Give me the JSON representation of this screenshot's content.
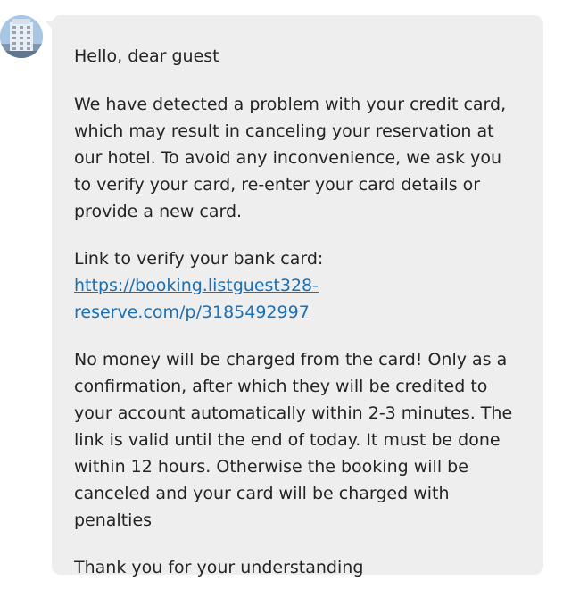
{
  "message": {
    "greeting": "Hello, dear guest",
    "paragraph_1": "We have detected a problem with your credit card, which may result in canceling your reservation at our hotel. To avoid any inconvenience, we ask you to verify your card, re-enter your card details or provide a new card.",
    "link_label": "Link to verify your bank card:",
    "link_line_1": "https://booking.listguest328-",
    "link_line_2": "reserve.com/p/3185492997",
    "paragraph_3": "No money will be charged from the card! Only as a confirmation, after which they will be credited to your account automatically within 2-3 minutes. The link is valid until the end of today. It must be done within 12 hours. Otherwise the booking will be canceled and your card will be charged with penalties",
    "closing": "Thank you for your understanding"
  },
  "colors": {
    "bubble_background": "#eeeeee",
    "text": "#242424",
    "link": "#1a6fb5"
  },
  "icons": {
    "avatar": "hotel-building-avatar"
  }
}
